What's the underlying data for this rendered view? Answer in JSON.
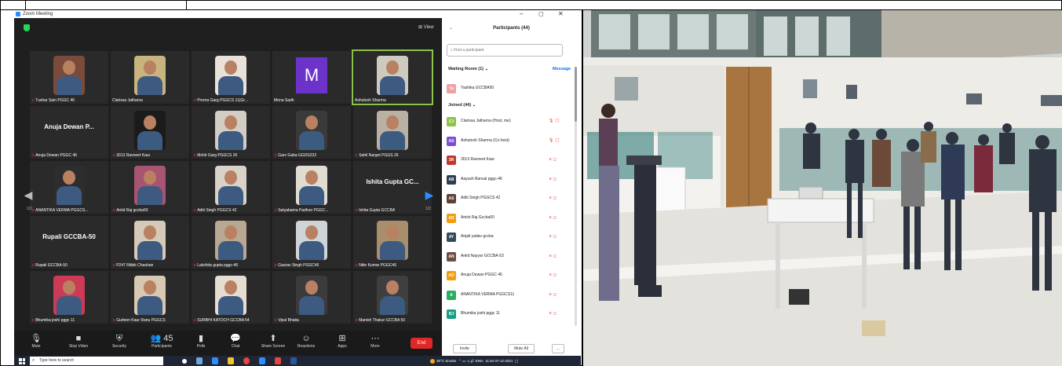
{
  "window": {
    "title": "Zoom Meeting",
    "minimize": "–",
    "maximize": "◻",
    "close": "✕"
  },
  "video": {
    "view_label": "View"
  },
  "tiles": [
    {
      "name": "Tushar Sain PGGC 46",
      "kind": "video",
      "color": "#7a4b3a"
    },
    {
      "name": "Clarissa Jatharna",
      "kind": "video",
      "color": "#c9b37e"
    },
    {
      "name": "Prerna Garg PGGCS 11(Gr...",
      "kind": "video",
      "color": "#e8e2da"
    },
    {
      "name": "Mona Sadh",
      "kind": "avatar",
      "initial": "M"
    },
    {
      "name": "Ashutosh Sharma",
      "kind": "video",
      "color": "#cfcac0"
    },
    {
      "name": "Anuja Dewan PGGC 46",
      "kind": "text",
      "bigname": "Anuja Dewan P..."
    },
    {
      "name": "3013 Ravneet Kaur",
      "kind": "video",
      "color": "#1b1b1b"
    },
    {
      "name": "Mohit Garg PGGCS 26",
      "kind": "video",
      "color": "#d2cdc5"
    },
    {
      "name": "Garv Gaba GGDS232",
      "kind": "video",
      "color": "#3a3a3a"
    },
    {
      "name": "Sahil Narget PGGS 26",
      "kind": "video",
      "color": "#b9b1a4"
    },
    {
      "name": "ANANTIKA VERMA PGGCS...",
      "kind": "video",
      "color": "#2d2d2d"
    },
    {
      "name": "Ankit Raj gccba50",
      "kind": "video",
      "color": "#a85472"
    },
    {
      "name": "Aditi Singh PGGCS 42",
      "kind": "video",
      "color": "#d8d2c8"
    },
    {
      "name": "Satyabama Padhoo PGGC...",
      "kind": "video",
      "color": "#e1dcd2"
    },
    {
      "name": "Ishita Gupta GCCBA",
      "kind": "text",
      "bigname": "Ishita Gupta GC..."
    },
    {
      "name": "Rupali GCCBA-50",
      "kind": "text",
      "bigname": "Rupali GCCBA-50"
    },
    {
      "name": "P247 Ritbik Chauhan",
      "kind": "video",
      "color": "#d6c9b8"
    },
    {
      "name": "Lakshita gupta pggc-46",
      "kind": "video",
      "color": "#b8a893"
    },
    {
      "name": "Gaurav Singh PGGC46",
      "kind": "video",
      "color": "#cfd4d8"
    },
    {
      "name": "Nitin Kumar PGGC46",
      "kind": "video",
      "color": "#a88e6c"
    },
    {
      "name": "Bhumika joshi pggc 11",
      "kind": "video",
      "color": "#cc3b55"
    },
    {
      "name": "Gurleen Kaur Ranu PGGCS",
      "kind": "video",
      "color": "#d7c8b2"
    },
    {
      "name": "SURBHI KATOCH GCCBA 54",
      "kind": "video",
      "color": "#e6ddd2"
    },
    {
      "name": "Vipul Bhatia",
      "kind": "video",
      "color": "#3b3b3b"
    },
    {
      "name": "Manish Thakur GCCBA 50",
      "kind": "video",
      "color": "#3f3f3f"
    }
  ],
  "pager": {
    "left": "1/2",
    "right": "1/2"
  },
  "toolbar": [
    {
      "icon": "🎙",
      "label": "Mute"
    },
    {
      "icon": "■",
      "label": "Stop Video"
    },
    {
      "icon": "⛨",
      "label": "Security"
    },
    {
      "icon": "👥",
      "label": "Participants",
      "badge": "45"
    },
    {
      "icon": "▮",
      "label": "Polls"
    },
    {
      "icon": "💬",
      "label": "Chat"
    },
    {
      "icon": "⬆",
      "label": "Share Screen"
    },
    {
      "icon": "☺",
      "label": "Reactions"
    },
    {
      "icon": "⊞",
      "label": "Apps"
    },
    {
      "icon": "⋯",
      "label": "More"
    }
  ],
  "end_label": "End",
  "participants": {
    "title": "Participants (44)",
    "search_placeholder": "Find a participant",
    "waiting_label": "Waiting Room (1)",
    "message_label": "Message",
    "joined_label": "Joined (44)",
    "waiting": [
      {
        "initials": "Ya",
        "name": "Yashika GCCBA50",
        "color": "#f0a0a0"
      }
    ],
    "list": [
      {
        "initials": "CJ",
        "name": "Clarissa Jatharna (Host, me)",
        "color": "#8bc34a",
        "icon": "🎙 ◻"
      },
      {
        "initials": "AS",
        "name": "Ashutosh Sharma (Co-host)",
        "color": "#7b4fd1",
        "icon": "🎙 ◻"
      },
      {
        "initials": "3R",
        "name": "3013 Ravneet Kaur",
        "color": "#c0392b",
        "icon": "⨯ ◻"
      },
      {
        "initials": "AB",
        "name": "Aayush Bansal pggc-46",
        "color": "#2c3e50",
        "icon": "⨯ ◻"
      },
      {
        "initials": "AS",
        "name": "Aditi Singh PGGCS 42",
        "color": "#5d4037",
        "icon": "⨯ ◻"
      },
      {
        "initials": "AR",
        "name": "Anish Raj Gccba50",
        "color": "#f39c12",
        "icon": "⨯ ◻"
      },
      {
        "initials": "AY",
        "name": "Anjali yadav gccba",
        "color": "#34495e",
        "icon": "⨯ ◻"
      },
      {
        "initials": "AN",
        "name": "Ankit Nayyar GCCBA-53",
        "color": "#6d4c41",
        "icon": "⨯ ◻"
      },
      {
        "initials": "AD",
        "name": "Anuja Dewan PGGC 46",
        "color": "#f39c12",
        "icon": "⨯ ◻"
      },
      {
        "initials": "A",
        "name": "ANANTIKA VERMA PGGCS11",
        "color": "#27ae60",
        "icon": "⨯ ◻"
      },
      {
        "initials": "BJ",
        "name": "Bhumika joshi pggc 11",
        "color": "#16a085",
        "icon": "⨯ ◻"
      }
    ],
    "invite_label": "Invite",
    "mute_all_label": "Mute All",
    "more_label": "..."
  },
  "taskbar": {
    "search_placeholder": "Type here to search",
    "weather": "30°C Smoke",
    "lang": "ENG",
    "time": "11:52",
    "date": "07-12-2021"
  }
}
